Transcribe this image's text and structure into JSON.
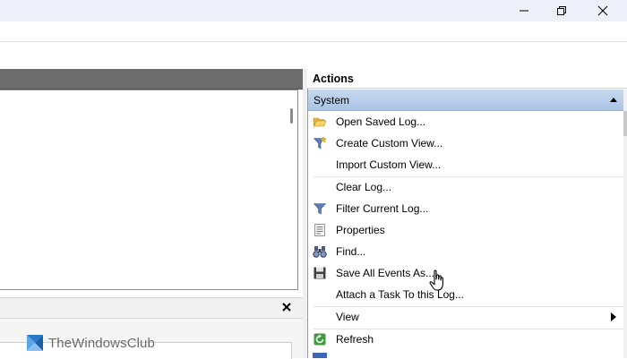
{
  "window": {
    "minimize_glyph": "—",
    "maximize_glyph": "⧉",
    "close_glyph": "✕"
  },
  "actions_pane": {
    "title": "Actions",
    "section": {
      "label": "System",
      "expanded": true
    },
    "items": [
      {
        "label": "Open Saved Log...",
        "icon": "open-folder-icon"
      },
      {
        "label": "Create Custom View...",
        "icon": "funnel-star-icon"
      },
      {
        "label": "Import Custom View...",
        "icon": ""
      },
      {
        "label": "Clear Log...",
        "icon": ""
      },
      {
        "label": "Filter Current Log...",
        "icon": "funnel-icon"
      },
      {
        "label": "Properties",
        "icon": "properties-icon"
      },
      {
        "label": "Find...",
        "icon": "binoculars-icon"
      },
      {
        "label": "Save All Events As...",
        "icon": "floppy-disk-icon"
      },
      {
        "label": "Attach a Task To this Log...",
        "icon": ""
      },
      {
        "label": "View",
        "icon": "",
        "submenu": true
      },
      {
        "label": "Refresh",
        "icon": "refresh-icon"
      }
    ]
  },
  "bottom_panel": {
    "close_glyph": "✕"
  },
  "watermark": {
    "text": "TheWindowsClub"
  },
  "colors": {
    "section_header": "#b8cfec",
    "panel_header_dark": "#6d6d6d",
    "title_bar": "#eef1f9"
  }
}
